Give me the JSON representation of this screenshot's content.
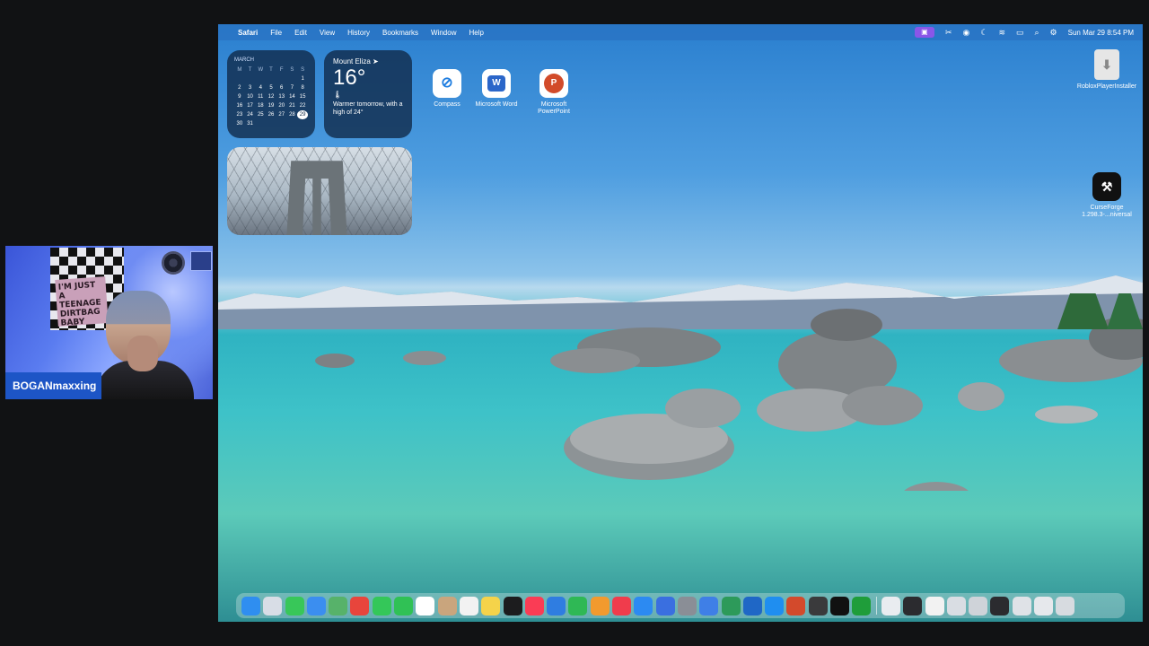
{
  "webcam": {
    "name_tag": "BOGANmaxxing",
    "sign_text": "I'M JUST A TEENAGE DIRTBAG BABY"
  },
  "menubar": {
    "app_name": "Safari",
    "items": [
      "File",
      "Edit",
      "View",
      "History",
      "Bookmarks",
      "Window",
      "Help"
    ],
    "clock": "Sun Mar 29  8:54 PM",
    "status_icons": [
      "screen-record-icon",
      "tools-icon",
      "play-circle-icon",
      "moon-icon",
      "wifi-icon",
      "battery-icon",
      "search-icon",
      "control-center-icon"
    ]
  },
  "calendar_widget": {
    "month": "MARCH",
    "day_headers": [
      "M",
      "T",
      "W",
      "T",
      "F",
      "S",
      "S"
    ],
    "weeks": [
      [
        "",
        "",
        "",
        "",
        "",
        "",
        "1"
      ],
      [
        "2",
        "3",
        "4",
        "5",
        "6",
        "7",
        "8"
      ],
      [
        "9",
        "10",
        "11",
        "12",
        "13",
        "14",
        "15"
      ],
      [
        "16",
        "17",
        "18",
        "19",
        "20",
        "21",
        "22"
      ],
      [
        "23",
        "24",
        "25",
        "26",
        "27",
        "28",
        "29"
      ],
      [
        "30",
        "31",
        "",
        "",
        "",
        "",
        ""
      ]
    ],
    "today": "29"
  },
  "weather_widget": {
    "location": "Mount Eliza ➤",
    "temperature": "16°",
    "description": "Warmer tomorrow, with a high of 24°"
  },
  "desktop_icons": {
    "compass": "Compass",
    "word": "Microsoft Word",
    "powerpoint": "Microsoft PowerPoint",
    "roblox": "RobloxPlayerInstaller",
    "curseforge": "CurseForge 1.298.3-...niversal"
  },
  "dock": {
    "items": [
      {
        "name": "finder-icon",
        "color": "#2f8ef0"
      },
      {
        "name": "launchpad-icon",
        "color": "#d8dde6"
      },
      {
        "name": "messages-icon",
        "color": "#38c759"
      },
      {
        "name": "mail-icon",
        "color": "#3b8ef0"
      },
      {
        "name": "maps-icon",
        "color": "#57b26a"
      },
      {
        "name": "chrome-icon",
        "color": "#e8453c"
      },
      {
        "name": "facetime-icon",
        "color": "#34c759"
      },
      {
        "name": "phone-icon",
        "color": "#30c155"
      },
      {
        "name": "calendar-icon",
        "color": "#ffffff"
      },
      {
        "name": "contacts-icon",
        "color": "#c9a57d"
      },
      {
        "name": "reminders-icon",
        "color": "#f2f2f2"
      },
      {
        "name": "notes-icon",
        "color": "#f5d34a"
      },
      {
        "name": "apple-tv-icon",
        "color": "#1c1c1e"
      },
      {
        "name": "music-icon",
        "color": "#fa3c55"
      },
      {
        "name": "keynote-icon",
        "color": "#2f7de1"
      },
      {
        "name": "numbers-icon",
        "color": "#2fb855"
      },
      {
        "name": "pages-icon",
        "color": "#f29a2e"
      },
      {
        "name": "news-icon",
        "color": "#f03c4c"
      },
      {
        "name": "app-store-icon",
        "color": "#2c8af2"
      },
      {
        "name": "books-icon",
        "color": "#3a6fe0"
      },
      {
        "name": "settings-icon",
        "color": "#8a8e96"
      },
      {
        "name": "xcode-icon",
        "color": "#3f7fe6"
      },
      {
        "name": "excel-icon",
        "color": "#2d9a5a"
      },
      {
        "name": "outlook-icon",
        "color": "#1f67c6"
      },
      {
        "name": "safari-icon",
        "color": "#1f8ef0"
      },
      {
        "name": "powerpoint-dock-icon",
        "color": "#d34a2c"
      },
      {
        "name": "calculator-icon",
        "color": "#3a3a3c"
      },
      {
        "name": "curseforge-dock-icon",
        "color": "#111111"
      },
      {
        "name": "minecraft-launcher-icon",
        "color": "#1f9d3a"
      },
      {
        "name": "preview-icon",
        "color": "#e9ecf0"
      },
      {
        "name": "utility-icon",
        "color": "#2b2b2f"
      },
      {
        "name": "minimized-window-1",
        "color": "#f2f2f2"
      },
      {
        "name": "minimized-window-2",
        "color": "#d9dde3"
      },
      {
        "name": "minimized-window-3",
        "color": "#cfd3d9"
      },
      {
        "name": "minimized-window-4",
        "color": "#2b2b2f"
      },
      {
        "name": "minimized-window-5",
        "color": "#dfe2e7"
      },
      {
        "name": "minimized-window-6",
        "color": "#e6e8ec"
      },
      {
        "name": "trash-icon",
        "color": "#d7dbe0"
      }
    ]
  }
}
